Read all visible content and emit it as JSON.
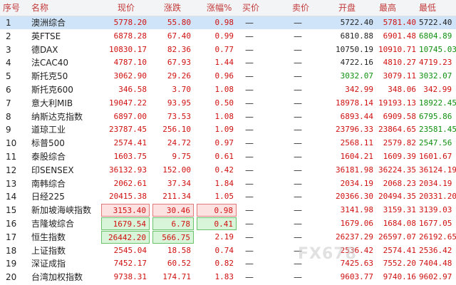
{
  "headers": [
    "序号",
    "名称",
    "现价",
    "涨跌",
    "涨幅%",
    "买价",
    "卖价",
    "开盘",
    "最高",
    "最低"
  ],
  "rows": [
    {
      "no": "1",
      "name": "澳洲综合",
      "price": "5778.20",
      "chg": "55.80",
      "pct": "0.98",
      "bid": "—",
      "ask": "—",
      "open": "5722.40",
      "high": "5781.40",
      "low": "5722.40"
    },
    {
      "no": "2",
      "name": "英FTSE",
      "price": "6878.28",
      "chg": "67.40",
      "pct": "0.99",
      "bid": "—",
      "ask": "—",
      "open": "6810.88",
      "high": "6901.48",
      "low": "6804.89"
    },
    {
      "no": "3",
      "name": "德DAX",
      "price": "10830.17",
      "chg": "82.36",
      "pct": "0.77",
      "bid": "—",
      "ask": "—",
      "open": "10750.19",
      "high": "10910.71",
      "low": "10745.03"
    },
    {
      "no": "4",
      "name": "法CAC40",
      "price": "4787.10",
      "chg": "67.93",
      "pct": "1.44",
      "bid": "—",
      "ask": "—",
      "open": "4722.16",
      "high": "4810.27",
      "low": "4719.23"
    },
    {
      "no": "5",
      "name": "斯托克50",
      "price": "3062.90",
      "chg": "29.26",
      "pct": "0.96",
      "bid": "—",
      "ask": "—",
      "open": "3032.07",
      "high": "3079.11",
      "low": "3032.07"
    },
    {
      "no": "6",
      "name": "斯托克600",
      "price": "346.58",
      "chg": "3.70",
      "pct": "1.08",
      "bid": "—",
      "ask": "—",
      "open": "342.99",
      "high": "348.06",
      "low": "342.99"
    },
    {
      "no": "7",
      "name": "意大利MIB",
      "price": "19047.22",
      "chg": "93.95",
      "pct": "0.50",
      "bid": "—",
      "ask": "—",
      "open": "18978.14",
      "high": "19193.13",
      "low": "18922.45"
    },
    {
      "no": "8",
      "name": "纳斯达克指数",
      "price": "6897.00",
      "chg": "73.53",
      "pct": "1.08",
      "bid": "—",
      "ask": "—",
      "open": "6893.44",
      "high": "6909.58",
      "low": "6795.86"
    },
    {
      "no": "9",
      "name": "道琼工业",
      "price": "23787.45",
      "chg": "256.10",
      "pct": "1.09",
      "bid": "—",
      "ask": "—",
      "open": "23796.33",
      "high": "23864.65",
      "low": "23581.45"
    },
    {
      "no": "10",
      "name": "标普500",
      "price": "2574.41",
      "chg": "24.72",
      "pct": "0.97",
      "bid": "—",
      "ask": "—",
      "open": "2568.11",
      "high": "2579.82",
      "low": "2547.56"
    },
    {
      "no": "11",
      "name": "泰股综合",
      "price": "1603.75",
      "chg": "9.75",
      "pct": "0.61",
      "bid": "—",
      "ask": "—",
      "open": "1604.21",
      "high": "1609.39",
      "low": "1601.67"
    },
    {
      "no": "12",
      "name": "印SENSEX",
      "price": "36132.93",
      "chg": "152.00",
      "pct": "0.42",
      "bid": "—",
      "ask": "—",
      "open": "36181.98",
      "high": "36224.35",
      "low": "36124.19"
    },
    {
      "no": "13",
      "name": "南韩综合",
      "price": "2062.61",
      "chg": "37.34",
      "pct": "1.84",
      "bid": "—",
      "ask": "—",
      "open": "2034.19",
      "high": "2068.23",
      "low": "2034.19"
    },
    {
      "no": "14",
      "name": "日经225",
      "price": "20415.38",
      "chg": "211.34",
      "pct": "1.05",
      "bid": "—",
      "ask": "—",
      "open": "20366.30",
      "high": "20494.35",
      "low": "20331.20"
    },
    {
      "no": "15",
      "name": "新加坡海峡指数",
      "price": "3153.40",
      "chg": "30.46",
      "pct": "0.98",
      "bid": "—",
      "ask": "—",
      "open": "3141.98",
      "high": "3159.31",
      "low": "3139.03"
    },
    {
      "no": "16",
      "name": "吉隆坡综合",
      "price": "1679.54",
      "chg": "6.78",
      "pct": "0.41",
      "bid": "—",
      "ask": "—",
      "open": "1679.06",
      "high": "1684.08",
      "low": "1677.05"
    },
    {
      "no": "17",
      "name": "恒生指数",
      "price": "26442.20",
      "chg": "566.75",
      "pct": "2.19",
      "bid": "—",
      "ask": "—",
      "open": "26237.29",
      "high": "26597.07",
      "low": "26192.65"
    },
    {
      "no": "18",
      "name": "上证指数",
      "price": "2545.04",
      "chg": "18.58",
      "pct": "0.74",
      "bid": "—",
      "ask": "—",
      "open": "2536.42",
      "high": "2574.41",
      "low": "2536.42"
    },
    {
      "no": "19",
      "name": "深证成指",
      "price": "7452.17",
      "chg": "60.52",
      "pct": "0.82",
      "bid": "—",
      "ask": "—",
      "open": "7425.63",
      "high": "7552.20",
      "low": "7404.48"
    },
    {
      "no": "20",
      "name": "台湾加权指数",
      "price": "9738.31",
      "chg": "174.71",
      "pct": "1.83",
      "bid": "—",
      "ask": "—",
      "open": "9603.77",
      "high": "9740.16",
      "low": "9602.97"
    }
  ],
  "colors": {
    "up": "#d01010",
    "down": "#109010",
    "header": "#c23a3a",
    "selected": "#cfe4f8"
  }
}
